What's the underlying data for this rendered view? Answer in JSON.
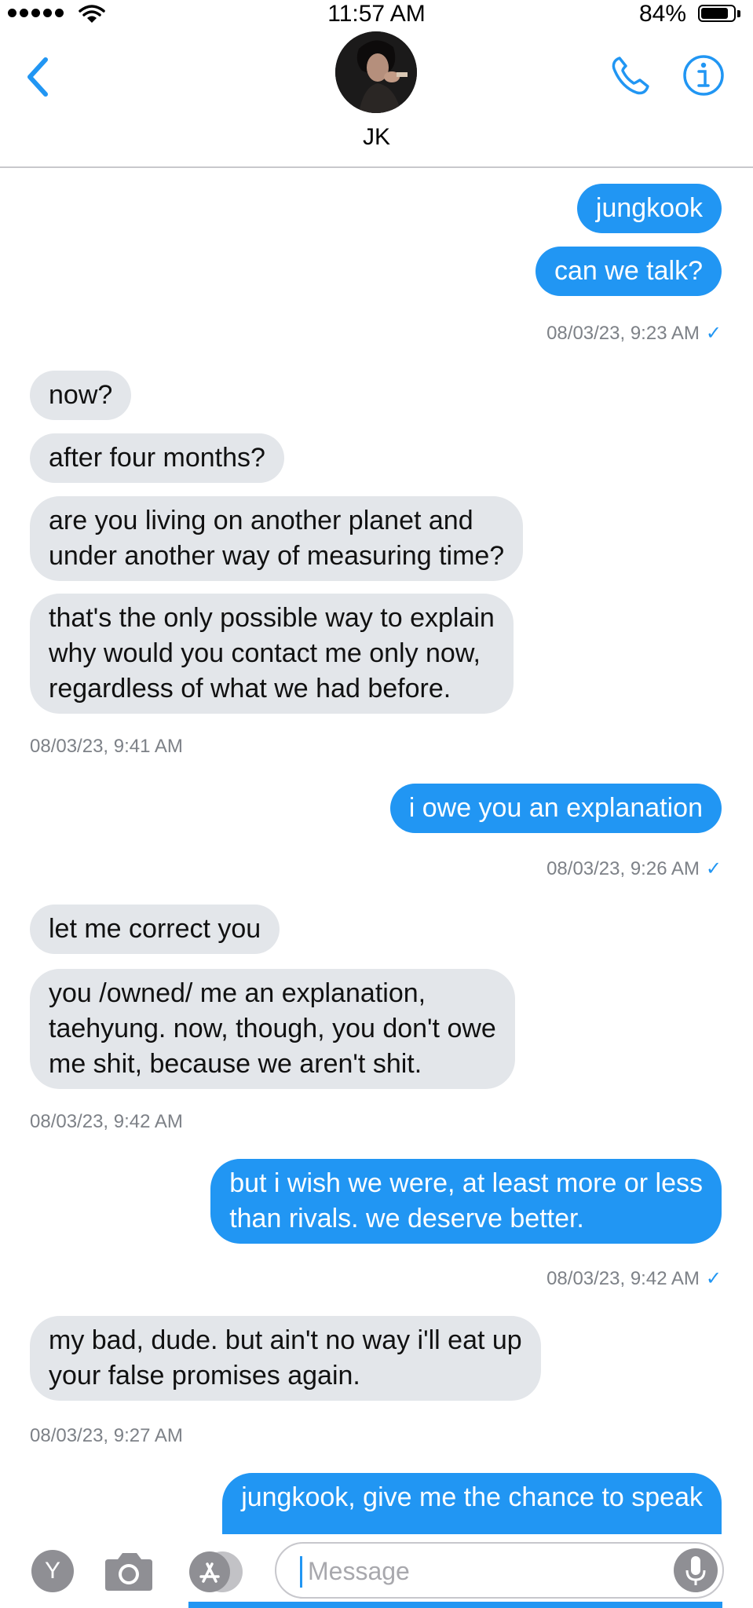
{
  "status_bar": {
    "time": "11:57 AM",
    "battery_percent": "84%",
    "battery_level": 0.84,
    "signal_bars": 5
  },
  "header": {
    "contact_name": "JK",
    "back_icon": "chevron-left-icon",
    "call_icon": "phone-icon",
    "info_icon": "info-icon"
  },
  "colors": {
    "accent": "#2196f3",
    "incoming_bubble": "#e3e6ea",
    "meta_text": "#7d8187"
  },
  "messages": [
    {
      "dir": "out",
      "text": "jungkook"
    },
    {
      "dir": "out",
      "text": "can we talk?"
    },
    {
      "meta": "08/03/23, 9:23 AM",
      "delivered": "✓"
    },
    {
      "dir": "in",
      "text": "now?"
    },
    {
      "dir": "in",
      "text": "after four months?"
    },
    {
      "dir": "in",
      "text": "are you living on another planet and\nunder another way of measuring time?"
    },
    {
      "dir": "in",
      "text": "that's the only possible way to explain\nwhy would you contact me only now,\nregardless of what we had before."
    },
    {
      "meta": "08/03/23, 9:41 AM"
    },
    {
      "dir": "out",
      "text": "i owe you an explanation"
    },
    {
      "meta": "08/03/23, 9:26 AM",
      "delivered": "✓"
    },
    {
      "dir": "in",
      "text": "let me correct you"
    },
    {
      "dir": "in",
      "text": "you /owned/ me an explanation,\ntaehyung. now, though, you don't owe\nme shit, because we aren't shit."
    },
    {
      "meta": "08/03/23, 9:42 AM"
    },
    {
      "dir": "out",
      "text": "but i wish we were, at least more or less\nthan rivals. we deserve better."
    },
    {
      "meta": "08/03/23, 9:42 AM",
      "delivered": "✓"
    },
    {
      "dir": "in",
      "text": "my bad, dude. but ain't no way i'll eat up\nyour false promises again."
    },
    {
      "meta": "08/03/23, 9:27 AM"
    },
    {
      "dir": "out",
      "text": "jungkook, give me the chance to speak"
    }
  ],
  "input_bar": {
    "y_button_label": "Y",
    "placeholder": "Message",
    "camera_icon": "camera-icon",
    "appstore_icon": "app-store-icon",
    "mic_icon": "microphone-icon"
  }
}
